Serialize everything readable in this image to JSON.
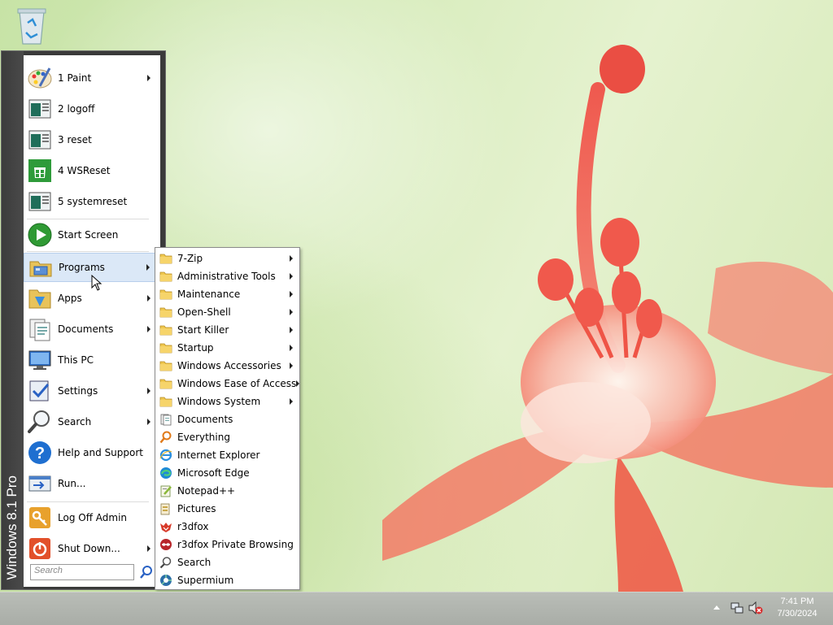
{
  "start_menu": {
    "brand": "Windows 8.1 Pro",
    "items": [
      {
        "label": "1 Paint",
        "icon": "paint-icon",
        "arrow": true
      },
      {
        "label": "2 logoff",
        "icon": "shortcut-icon",
        "arrow": false
      },
      {
        "label": "3 reset",
        "icon": "shortcut-icon",
        "arrow": false
      },
      {
        "label": "4 WSReset",
        "icon": "store-icon",
        "arrow": false
      },
      {
        "label": "5 systemreset",
        "icon": "shortcut-icon",
        "arrow": false
      },
      {
        "label": "Start Screen",
        "icon": "play-icon",
        "arrow": false
      },
      {
        "label": "Programs",
        "icon": "programs-icon",
        "arrow": true
      },
      {
        "label": "Apps",
        "icon": "apps-icon",
        "arrow": true
      },
      {
        "label": "Documents",
        "icon": "documents-icon",
        "arrow": true
      },
      {
        "label": "This PC",
        "icon": "computer-icon",
        "arrow": false
      },
      {
        "label": "Settings",
        "icon": "settings-icon",
        "arrow": true
      },
      {
        "label": "Search",
        "icon": "search-icon",
        "arrow": true
      },
      {
        "label": "Help and Support",
        "icon": "help-icon",
        "arrow": false
      },
      {
        "label": "Run...",
        "icon": "run-icon",
        "arrow": false
      },
      {
        "label": "Log Off Admin",
        "icon": "logoff-icon",
        "arrow": false
      },
      {
        "label": "Shut Down...",
        "icon": "shutdown-icon",
        "arrow": true
      }
    ],
    "search_placeholder": "Search"
  },
  "programs_submenu": {
    "items": [
      {
        "label": "7-Zip",
        "icon": "folder-icon",
        "arrow": true
      },
      {
        "label": "Administrative Tools",
        "icon": "folder-icon",
        "arrow": true
      },
      {
        "label": "Maintenance",
        "icon": "folder-icon",
        "arrow": true
      },
      {
        "label": "Open-Shell",
        "icon": "folder-icon",
        "arrow": true
      },
      {
        "label": "Start Killer",
        "icon": "folder-icon",
        "arrow": true
      },
      {
        "label": "Startup",
        "icon": "folder-icon",
        "arrow": true
      },
      {
        "label": "Windows Accessories",
        "icon": "folder-icon",
        "arrow": true
      },
      {
        "label": "Windows Ease of Access",
        "icon": "folder-icon",
        "arrow": true
      },
      {
        "label": "Windows System",
        "icon": "folder-icon",
        "arrow": true
      },
      {
        "label": "Documents",
        "icon": "documents-small-icon",
        "arrow": false
      },
      {
        "label": "Everything",
        "icon": "everything-icon",
        "arrow": false
      },
      {
        "label": "Internet Explorer",
        "icon": "ie-icon",
        "arrow": false
      },
      {
        "label": "Microsoft Edge",
        "icon": "edge-icon",
        "arrow": false
      },
      {
        "label": "Notepad++",
        "icon": "notepadpp-icon",
        "arrow": false
      },
      {
        "label": "Pictures",
        "icon": "pictures-icon",
        "arrow": false
      },
      {
        "label": "r3dfox",
        "icon": "r3dfox-icon",
        "arrow": false
      },
      {
        "label": "r3dfox Private Browsing",
        "icon": "r3dfox-private-icon",
        "arrow": false
      },
      {
        "label": "Search",
        "icon": "search-small-icon",
        "arrow": false
      },
      {
        "label": "Supermium",
        "icon": "supermium-icon",
        "arrow": false
      }
    ]
  },
  "taskbar": {
    "time": "7:41 PM",
    "date": "7/30/2024"
  }
}
